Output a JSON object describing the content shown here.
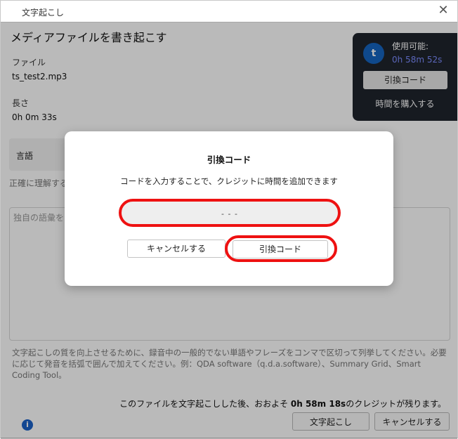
{
  "window": {
    "title": "文字起こし"
  },
  "main": {
    "heading": "メディアファイルを書き起こす",
    "file_label": "ファイル",
    "file_value": "ts_test2.mp3",
    "length_label": "長さ",
    "length_value": "0h 0m 33s",
    "language_label": "言語",
    "accuracy_hint": "正確に理解する",
    "vocab_placeholder": "独自の語彙を",
    "help_text": "文字起こしの質を向上させるために、録音中の一般的でない単語やフレーズをコンマで区切って列挙してください。必要に応じて発音を括弧で囲んで加えてください。例：QDA software（q.d.a.software）、Summary Grid、Smart Coding Tool。",
    "footer_note_prefix": "このファイルを文字起こしした後、おおよそ ",
    "footer_note_time": "0h 58m 18s",
    "footer_note_suffix": "のクレジットが残ります。",
    "transcribe_button": "文字起こし",
    "cancel_button": "キャンセルする"
  },
  "credit_panel": {
    "avatar_letter": "t",
    "available_label": "使用可能:",
    "available_time": "0h 58m 52s",
    "redeem_button": "引換コード",
    "buy_link": "時間を購入する"
  },
  "modal": {
    "title": "引換コード",
    "description": "コードを入力することで、クレジットに時間を追加できます",
    "code_value": "-   -   -",
    "cancel_button": "キャンセルする",
    "redeem_button": "引換コード"
  },
  "colors": {
    "highlight": "#ee1111",
    "accent": "#1565c0",
    "panel_bg": "#1f242d"
  }
}
